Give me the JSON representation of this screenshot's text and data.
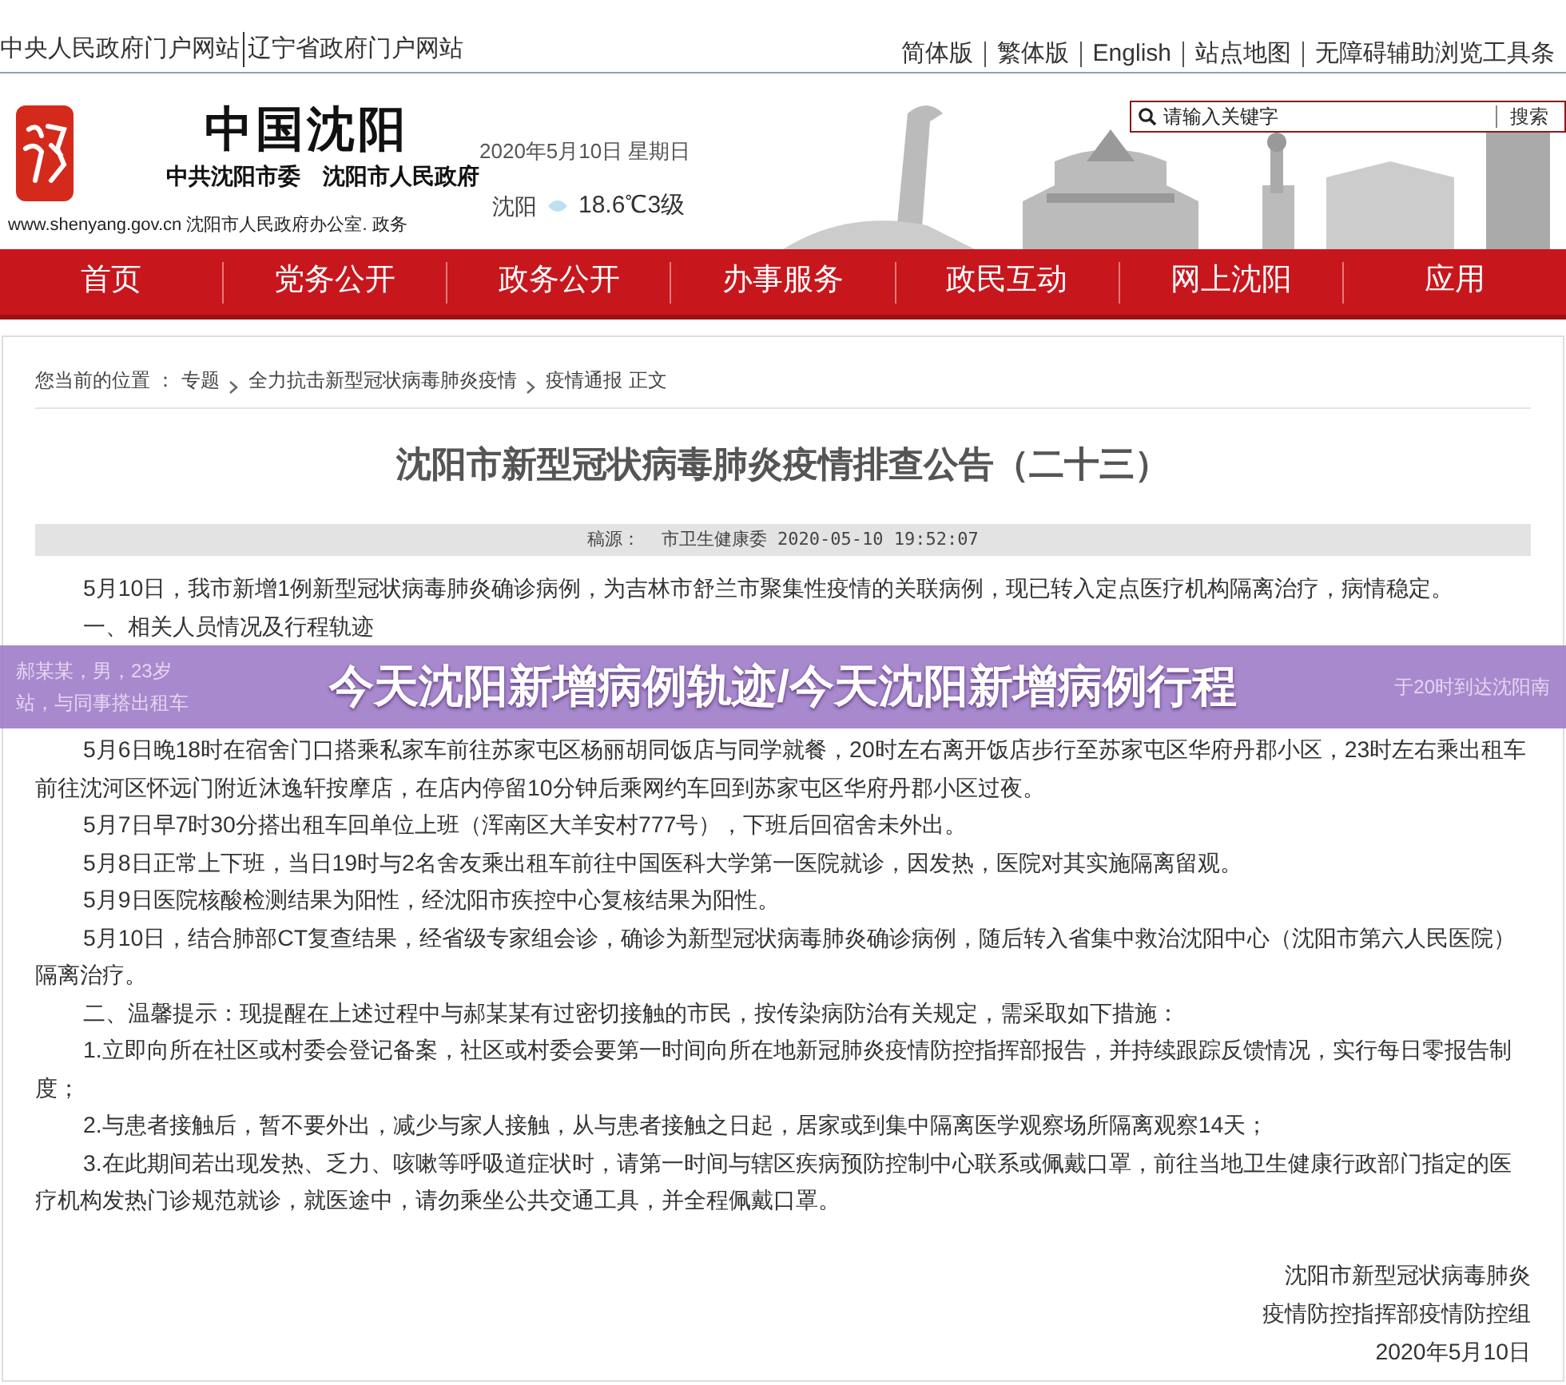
{
  "top_links": {
    "left": [
      "中央人民政府门户网站",
      "辽宁省政府门户网站"
    ],
    "right": [
      "简体版",
      "繁体版",
      "English",
      "站点地图",
      "无障碍辅助浏览工具条"
    ]
  },
  "header": {
    "site_title": "中国沈阳",
    "subtitle": "中共沈阳市委　沈阳市人民政府",
    "url_line": "www.shenyang.gov.cn 沈阳市人民政府办公室. 政务",
    "date": "2020年5月10日 星期日",
    "city": "沈阳",
    "weather": "18.6℃3级",
    "search": {
      "placeholder": "请输入关键字",
      "button": "搜索"
    }
  },
  "nav": [
    "首页",
    "党务公开",
    "政务公开",
    "办事服务",
    "政民互动",
    "网上沈阳",
    "应用"
  ],
  "breadcrumb": {
    "label": "您当前的位置 ：",
    "items": [
      "专题",
      "全力抗击新型冠状病毒肺炎疫情",
      "疫情通报"
    ],
    "current": "正文"
  },
  "article": {
    "title": "沈阳市新型冠状病毒肺炎疫情排查公告（二十三）",
    "source": "稿源：  市卫生健康委 2020-05-10 19:52:07",
    "paragraphs_before": [
      "5月10日，我市新增1例新型冠状病毒肺炎确诊病例，为吉林市舒兰市聚集性疫情的关联病例，现已转入定点医疗机构隔离治疗，病情稳定。",
      "一、相关人员情况及行程轨迹"
    ],
    "covered_fragments": {
      "left": [
        "郝某某，男，23岁",
        "站，与同事搭出租车"
      ],
      "right": [
        "于20时到达沈阳南"
      ]
    },
    "paragraphs_after": [
      "5月6日晚18时在宿舍门口搭乘私家车前往苏家屯区杨丽胡同饭店与同学就餐，20时左右离开饭店步行至苏家屯区华府丹郡小区，23时左右乘出租车前往沈河区怀远门附近沐逸轩按摩店，在店内停留10分钟后乘网约车回到苏家屯区华府丹郡小区过夜。",
      "5月7日早7时30分搭出租车回单位上班（浑南区大羊安村777号），下班后回宿舍未外出。",
      "5月8日正常上下班，当日19时与2名舍友乘出租车前往中国医科大学第一医院就诊，因发热，医院对其实施隔离留观。",
      "5月9日医院核酸检测结果为阳性，经沈阳市疾控中心复核结果为阳性。",
      "5月10日，结合肺部CT复查结果，经省级专家组会诊，确诊为新型冠状病毒肺炎确诊病例，随后转入省集中救治沈阳中心（沈阳市第六人民医院）隔离治疗。",
      "二、温馨提示：现提醒在上述过程中与郝某某有过密切接触的市民，按传染病防治有关规定，需采取如下措施：",
      "1.立即向所在社区或村委会登记备案，社区或村委会要第一时间向所在地新冠肺炎疫情防控指挥部报告，并持续跟踪反馈情况，实行每日零报告制度；",
      "2.与患者接触后，暂不要外出，减少与家人接触，从与患者接触之日起，居家或到集中隔离医学观察场所隔离观察14天；",
      "3.在此期间若出现发热、乏力、咳嗽等呼吸道症状时，请第一时间与辖区疾病预防控制中心联系或佩戴口罩，前往当地卫生健康行政部门指定的医疗机构发热门诊规范就诊，就医途中，请勿乘坐公共交通工具，并全程佩戴口罩。"
    ],
    "signature": [
      "沈阳市新型冠状病毒肺炎",
      "疫情防控指挥部疫情防控组",
      "2020年5月10日"
    ]
  },
  "overlay_banner": "今天沈阳新增病例轨迹/今天沈阳新增病例行程"
}
